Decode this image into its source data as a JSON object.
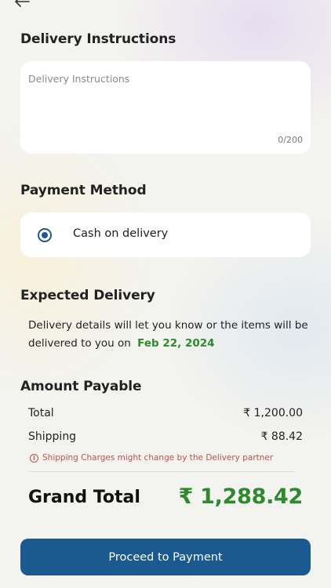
{
  "delivery_instructions": {
    "title": "Delivery Instructions",
    "placeholder": "Delivery Instructions",
    "value": "",
    "counter": "0/200"
  },
  "payment_method": {
    "title": "Payment Method",
    "option_label": "Cash on delivery",
    "selected": true
  },
  "expected_delivery": {
    "title": "Expected Delivery",
    "text": "Delivery details will let you know or the items will be delivered to you on",
    "date": "Feb 22, 2024"
  },
  "amount_payable": {
    "title": "Amount Payable",
    "total_label": "Total",
    "total_value": "₹ 1,200.00",
    "shipping_label": "Shipping",
    "shipping_value": "₹ 88.42",
    "shipping_note": "Shipping Charges might change by the Delivery partner",
    "info_icon_glyph": "i",
    "grand_total_label": "Grand Total",
    "grand_total_value": "₹ 1,288.42"
  },
  "actions": {
    "proceed_label": "Proceed to Payment"
  },
  "colors": {
    "accent": "#1b5a91",
    "success": "#2e8a2e",
    "warning": "#c0504a"
  },
  "icons": {
    "back": "arrow-left",
    "info": "info-circle"
  }
}
